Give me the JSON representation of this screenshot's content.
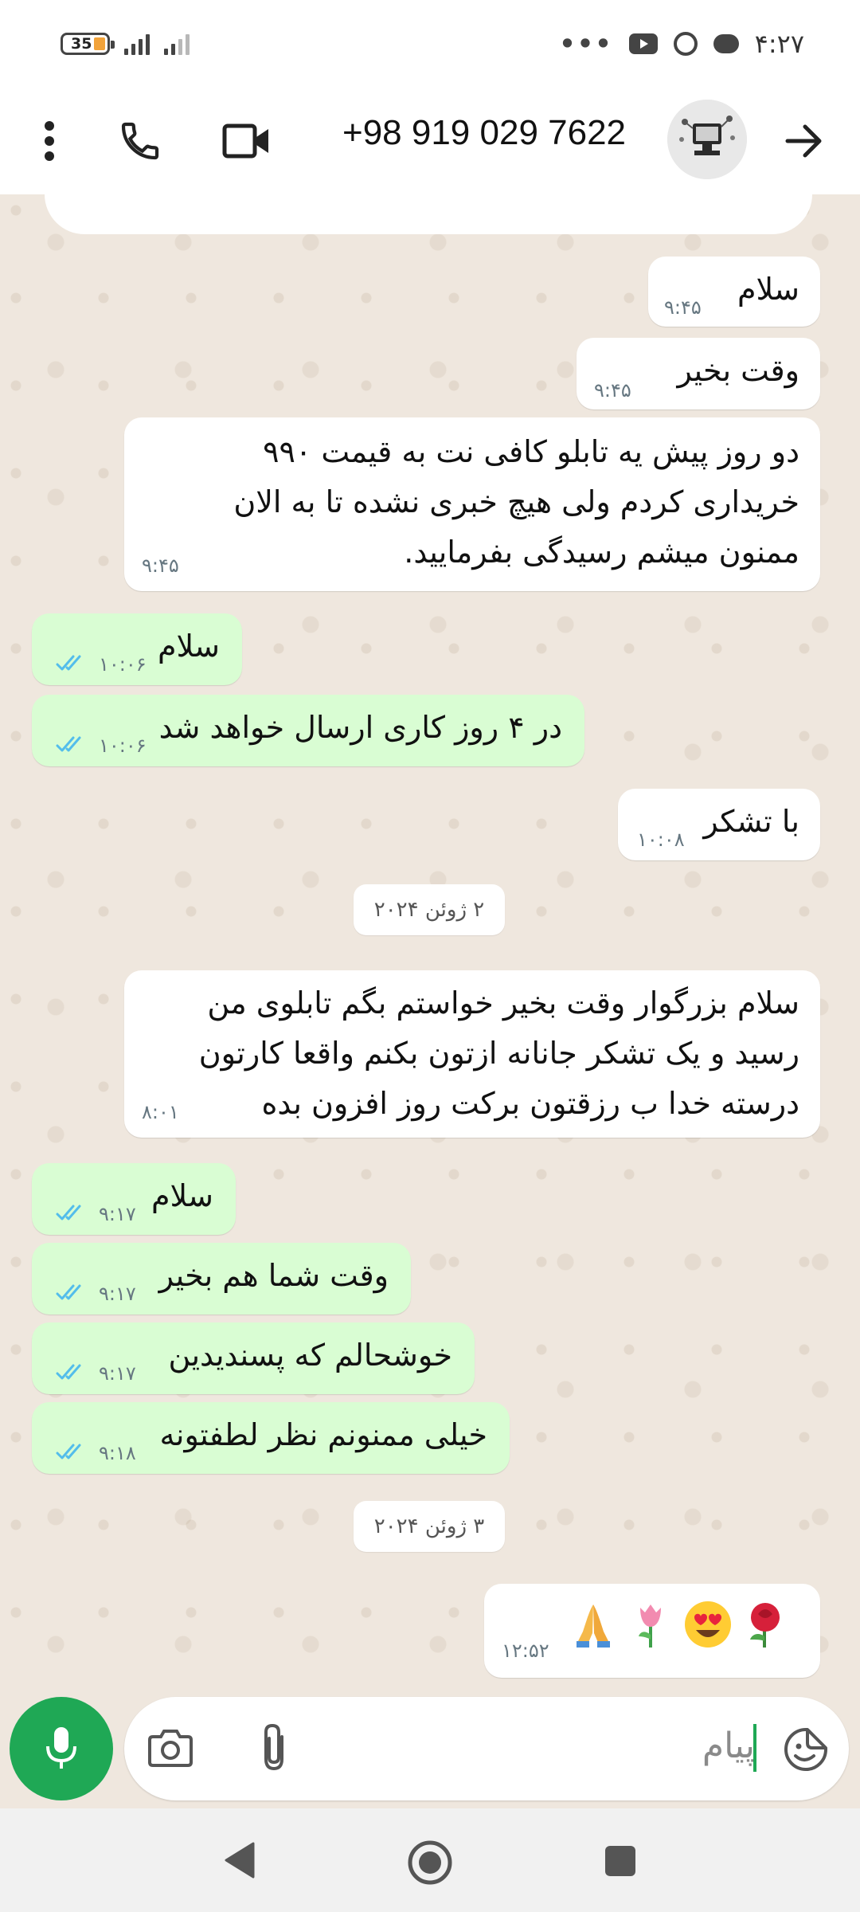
{
  "status_bar": {
    "battery_level": "35",
    "time": "۴:۲۷",
    "overflow": "•••",
    "icons": [
      "battery-icon",
      "signal-icon",
      "youtube-icon",
      "whatsapp-icon",
      "message-icon"
    ]
  },
  "header": {
    "contact_name": "+98 919 029 7622",
    "icons": [
      "back-arrow-icon",
      "avatar",
      "video-call-icon",
      "voice-call-icon",
      "more-options-icon"
    ]
  },
  "messages": [
    {
      "dir": "in",
      "text": "سلام",
      "time": "۹:۴۵"
    },
    {
      "dir": "in",
      "text": "وقت بخیر",
      "time": "۹:۴۵"
    },
    {
      "dir": "in",
      "text": "دو روز پیش یه تابلو کافی نت به قیمت ۹۹۰\nخریداری کردم ولی هیچ خبری نشده تا به الان\nممنون میشم رسیدگی بفرمایید.",
      "time": "۹:۴۵"
    },
    {
      "dir": "out",
      "text": "سلام",
      "time": "۱۰:۰۶",
      "read": true
    },
    {
      "dir": "out",
      "text": "در ۴ روز کاری ارسال خواهد شد",
      "time": "۱۰:۰۶",
      "read": true
    },
    {
      "dir": "in",
      "text": "با تشکر",
      "time": "۱۰:۰۸"
    },
    {
      "dir": "in",
      "text": "سلام بزرگوار وقت بخیر خواستم بگم تابلوی من\nرسید و یک تشکر جانانه ازتون بکنم واقعا کارتون\nدرسته خدا ب رزقتون برکت روز افزون بده",
      "time": "۸:۰۱"
    },
    {
      "dir": "out",
      "text": "سلام",
      "time": "۹:۱۷",
      "read": true
    },
    {
      "dir": "out",
      "text": "وقت شما هم بخیر",
      "time": "۹:۱۷",
      "read": true
    },
    {
      "dir": "out",
      "text": "خوشحالم که پسندیدین",
      "time": "۹:۱۷",
      "read": true
    },
    {
      "dir": "out",
      "text": "خیلی ممنونم نظر لطفتونه",
      "time": "۹:۱۸",
      "read": true
    },
    {
      "dir": "in",
      "emojis": [
        "rose-emoji",
        "heart-eyes-emoji",
        "tulip-emoji",
        "folded-hands-emoji"
      ],
      "time": "۱۲:۵۲"
    }
  ],
  "date_dividers": [
    "۲ ژوئن ۲۰۲۴",
    "۳ ژوئن ۲۰۲۴"
  ],
  "composer": {
    "placeholder": "پیام",
    "icons": [
      "sticker-icon",
      "attach-icon",
      "camera-icon",
      "mic-icon"
    ]
  },
  "navigation": {
    "icons": [
      "nav-back-icon",
      "nav-home-icon",
      "nav-recents-icon"
    ]
  },
  "colors": {
    "outgoing_bubble": "#d9fdd3",
    "incoming_bubble": "#ffffff",
    "accent": "#1fa855",
    "read_ticks": "#53bdeb",
    "chat_background": "#efe7de"
  }
}
